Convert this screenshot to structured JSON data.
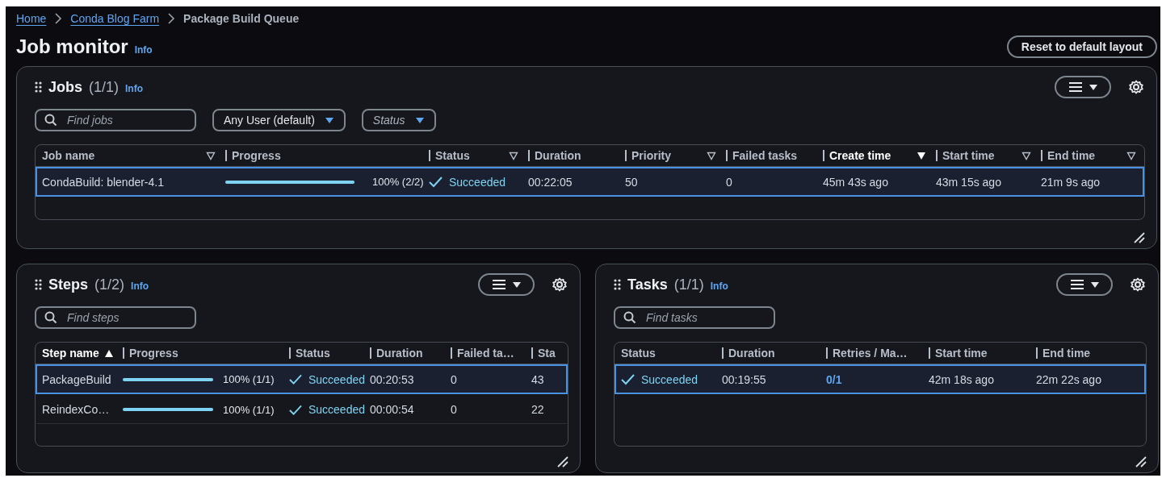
{
  "breadcrumbs": [
    {
      "label": "Home",
      "kind": "link"
    },
    {
      "label": "Conda Blog Farm",
      "kind": "link"
    },
    {
      "label": "Package Build Queue",
      "kind": "current"
    }
  ],
  "page": {
    "title": "Job monitor",
    "info": "Info",
    "reset_button": "Reset to default layout"
  },
  "panels": [
    {
      "title": "Jobs",
      "count": "(1/1)",
      "info": "Info",
      "filters": [
        {
          "kind": "search",
          "placeholder": "Find jobs"
        },
        {
          "kind": "select",
          "value": "Any User (default)"
        },
        {
          "kind": "select",
          "placeholder": "Status"
        }
      ],
      "table": {
        "columns": [
          {
            "label": "Job name",
            "sorted": false,
            "filterable": true
          },
          {
            "label": "Progress",
            "sorted": false,
            "filterable": false
          },
          {
            "label": "Status",
            "sorted": false,
            "filterable": true
          },
          {
            "label": "Duration",
            "sorted": false,
            "filterable": false
          },
          {
            "label": "Priority",
            "sorted": false,
            "filterable": true
          },
          {
            "label": "Failed tasks",
            "sorted": false,
            "filterable": false
          },
          {
            "label": "Create time",
            "sorted": true,
            "descending": true
          },
          {
            "label": "Start time",
            "sorted": false,
            "filterable": true
          },
          {
            "label": "End time",
            "sorted": false,
            "filterable": true
          }
        ],
        "rows": [
          {
            "selected": true,
            "cells": [
              {
                "kind": "text",
                "text": "CondaBuild: blender-4.1"
              },
              {
                "kind": "progress",
                "level": 1,
                "text": "100% (2/2)"
              },
              {
                "kind": "status",
                "text": "Succeeded"
              },
              {
                "kind": "text",
                "text": "00:22:05"
              },
              {
                "kind": "text",
                "text": "50"
              },
              {
                "kind": "text",
                "text": "0"
              },
              {
                "kind": "time",
                "text": "45m 43s ago"
              },
              {
                "kind": "time",
                "text": "43m 15s ago"
              },
              {
                "kind": "time",
                "text": "21m 9s ago"
              }
            ]
          }
        ]
      }
    },
    {
      "title": "Steps",
      "count": "(1/2)",
      "info": "Info",
      "filters": [
        {
          "kind": "search",
          "placeholder": "Find steps"
        }
      ],
      "table": {
        "columns": [
          {
            "label": "Step name",
            "sorted": true,
            "descending": false
          },
          {
            "label": "Progress",
            "sorted": false,
            "filterable": false
          },
          {
            "label": "Status",
            "sorted": false,
            "filterable": false
          },
          {
            "label": "Duration",
            "sorted": false,
            "filterable": false
          },
          {
            "label": "Failed ta…",
            "sorted": false,
            "filterable": false
          },
          {
            "label": "Sta",
            "sorted": false,
            "filterable": false
          }
        ],
        "rows": [
          {
            "selected": true,
            "cells": [
              {
                "kind": "text",
                "text": "PackageBuild"
              },
              {
                "kind": "progress",
                "level": 1,
                "text": "100% (1/1)"
              },
              {
                "kind": "status",
                "text": "Succeeded"
              },
              {
                "kind": "text",
                "text": "00:20:53"
              },
              {
                "kind": "text",
                "text": "0"
              },
              {
                "kind": "time",
                "text": "43"
              }
            ]
          },
          {
            "selected": false,
            "cells": [
              {
                "kind": "text",
                "text": "ReindexCo…"
              },
              {
                "kind": "progress",
                "level": 1,
                "text": "100% (1/1)"
              },
              {
                "kind": "status",
                "text": "Succeeded"
              },
              {
                "kind": "text",
                "text": "00:00:54"
              },
              {
                "kind": "text",
                "text": "0"
              },
              {
                "kind": "time",
                "text": "22"
              }
            ]
          }
        ]
      }
    },
    {
      "title": "Tasks",
      "count": "(1/1)",
      "info": "Info",
      "filters": [
        {
          "kind": "search",
          "placeholder": "Find tasks"
        }
      ],
      "table": {
        "columns": [
          {
            "label": "Status",
            "sorted": false,
            "filterable": false
          },
          {
            "label": "Duration",
            "sorted": false,
            "filterable": false
          },
          {
            "label": "Retries / Ma…",
            "sorted": false,
            "filterable": false
          },
          {
            "label": "Start time",
            "sorted": false,
            "filterable": false
          },
          {
            "label": "End time",
            "sorted": false,
            "filterable": false
          }
        ],
        "rows": [
          {
            "selected": true,
            "cells": [
              {
                "kind": "status",
                "text": "Succeeded"
              },
              {
                "kind": "text",
                "text": "00:19:55"
              },
              {
                "kind": "link",
                "text": "0/1"
              },
              {
                "kind": "time",
                "text": "42m 18s ago"
              },
              {
                "kind": "time",
                "text": "22m 22s ago"
              }
            ]
          }
        ]
      }
    }
  ]
}
